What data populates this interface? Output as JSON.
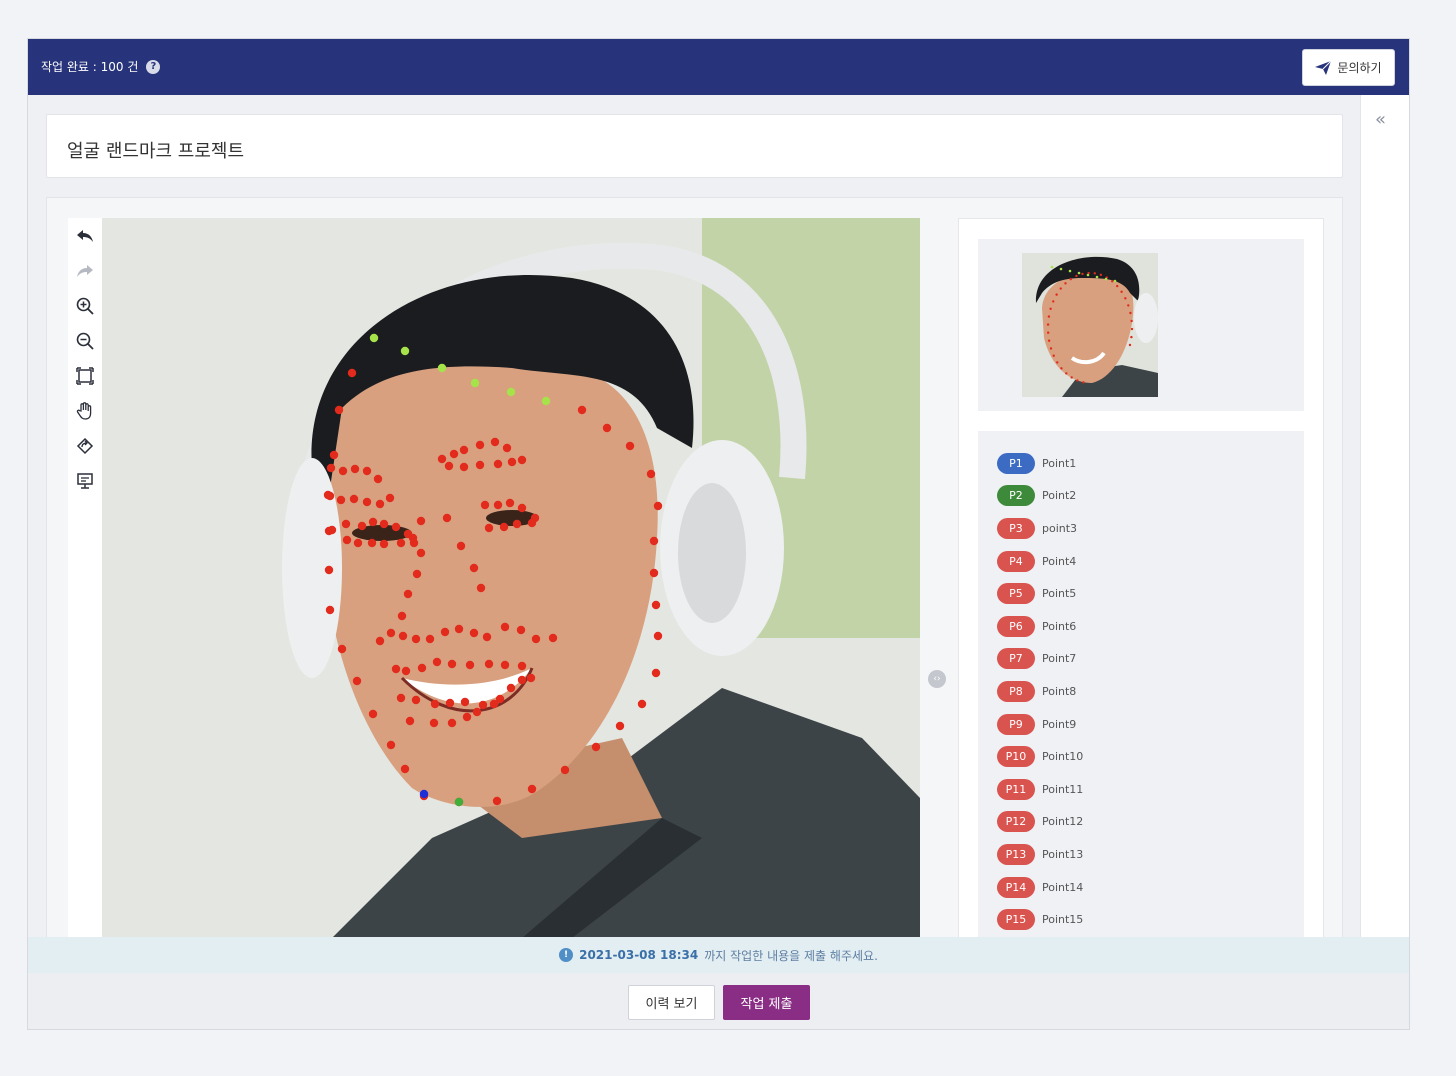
{
  "topbar": {
    "status_text": "작업 완료 : 100 건",
    "help_icon": "question-circle-icon",
    "inquiry_label": "문의하기",
    "inquiry_icon": "paper-plane-icon",
    "color": "#27337a"
  },
  "right_rail": {
    "collapse_icon": "double-chevron-left-icon",
    "collapse_glyph": "«"
  },
  "project": {
    "title": "얼굴 랜드마크 프로젝트"
  },
  "toolbar": {
    "tools": [
      {
        "name": "undo-icon"
      },
      {
        "name": "redo-icon"
      },
      {
        "name": "zoom-in-icon"
      },
      {
        "name": "zoom-out-icon"
      },
      {
        "name": "fit-screen-icon"
      },
      {
        "name": "pan-hand-icon"
      },
      {
        "name": "rotate-icon"
      },
      {
        "name": "presentation-icon"
      }
    ]
  },
  "canvas": {
    "point_colors": {
      "p1": "#1f2fd8",
      "p2": "#3fae3a",
      "brow": "#a6e34a",
      "default": "#e22a1d"
    }
  },
  "points": {
    "items": [
      {
        "badge": "P1",
        "label": "Point1",
        "color": "#3c6bc4"
      },
      {
        "badge": "P2",
        "label": "Point2",
        "color": "#3d8a3a"
      },
      {
        "badge": "P3",
        "label": "point3",
        "color": "#d9534f"
      },
      {
        "badge": "P4",
        "label": "Point4",
        "color": "#d9534f"
      },
      {
        "badge": "P5",
        "label": "Point5",
        "color": "#d9534f"
      },
      {
        "badge": "P6",
        "label": "Point6",
        "color": "#d9534f"
      },
      {
        "badge": "P7",
        "label": "Point7",
        "color": "#d9534f"
      },
      {
        "badge": "P8",
        "label": "Point8",
        "color": "#d9534f"
      },
      {
        "badge": "P9",
        "label": "Point9",
        "color": "#d9534f"
      },
      {
        "badge": "P10",
        "label": "Point10",
        "color": "#d9534f"
      },
      {
        "badge": "P11",
        "label": "Point11",
        "color": "#d9534f"
      },
      {
        "badge": "P12",
        "label": "Point12",
        "color": "#d9534f"
      },
      {
        "badge": "P13",
        "label": "Point13",
        "color": "#d9534f"
      },
      {
        "badge": "P14",
        "label": "Point14",
        "color": "#d9534f"
      },
      {
        "badge": "P15",
        "label": "Point15",
        "color": "#d9534f"
      }
    ]
  },
  "notice": {
    "icon": "info-circle-icon",
    "deadline": "2021-03-08 18:34",
    "message": "까지 작업한 내용을 제출 해주세요."
  },
  "footer": {
    "history_label": "이력 보기",
    "submit_label": "작업 제출",
    "submit_color": "#8a2e85"
  }
}
